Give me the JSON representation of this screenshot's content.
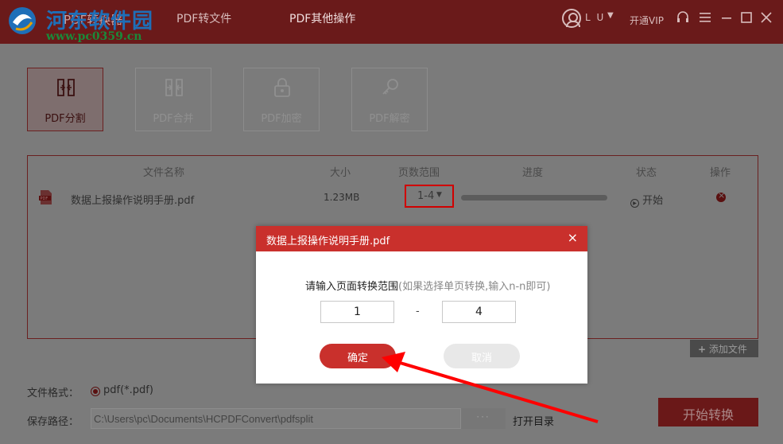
{
  "watermark": {
    "line1": "河东软件园",
    "line2": "www.pc0359.cn"
  },
  "titlebar": {
    "app_title": "PDF转换器",
    "tabs": [
      {
        "label": "PDF转文件"
      },
      {
        "label": "PDF其他操作"
      }
    ],
    "user_name": "L U",
    "vip": "开通VIP"
  },
  "tools": [
    {
      "label": "PDF分割"
    },
    {
      "label": "PDF合并"
    },
    {
      "label": "PDF加密"
    },
    {
      "label": "PDF解密"
    }
  ],
  "table": {
    "headers": {
      "name": "文件名称",
      "size": "大小",
      "range": "页数范围",
      "progress": "进度",
      "status": "状态",
      "action": "操作"
    },
    "row": {
      "name": "数据上报操作说明手册.pdf",
      "size": "1.23MB",
      "range": "1-4",
      "status": "开始"
    }
  },
  "add_file": "添加文件",
  "format": {
    "label": "文件格式：",
    "value": "pdf(*.pdf)"
  },
  "save_path": {
    "label": "保存路径：",
    "value": "C:\\Users\\pc\\Documents\\HCPDFConvert\\pdfsplit",
    "browse": "···",
    "open_dir": "打开目录"
  },
  "convert_button": "开始转换",
  "dialog": {
    "title": "数据上报操作说明手册.pdf",
    "prompt": "请输入页面转换范围",
    "hint": "(如果选择单页转换,输入n-n即可)",
    "from": "1",
    "separator": "-",
    "to": "4",
    "ok": "确定",
    "cancel": "取消"
  },
  "colors": {
    "brand_red": "#c9302c",
    "highlight_red": "#ff0000"
  }
}
